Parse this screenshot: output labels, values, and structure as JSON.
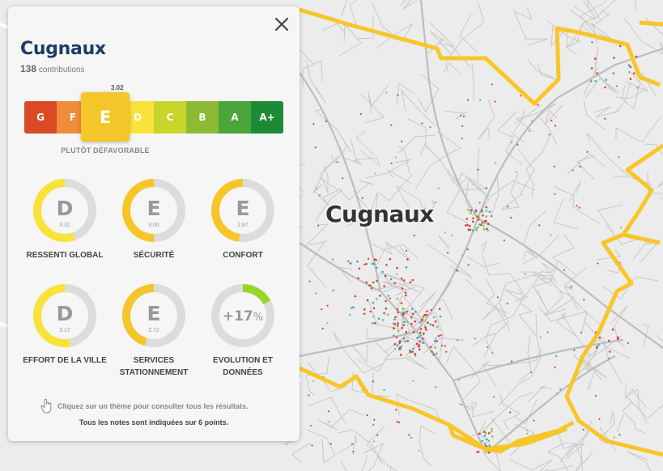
{
  "map": {
    "label": "Cugnaux"
  },
  "panel": {
    "title": "Cugnaux",
    "contributions_count": "138",
    "contributions_label": "contributions",
    "average_score": "3.02",
    "scale_caption": "PLUTÔT DÉFAVORABLE",
    "active_grade": "E",
    "grades": [
      {
        "label": "G",
        "color": "#d94a25"
      },
      {
        "label": "F",
        "color": "#ef8d3c"
      },
      {
        "label": "E",
        "color": "#f5c629"
      },
      {
        "label": "D",
        "color": "#f9e33a"
      },
      {
        "label": "C",
        "color": "#c9d52b"
      },
      {
        "label": "B",
        "color": "#8cbb33"
      },
      {
        "label": "A",
        "color": "#4aa53b"
      },
      {
        "label": "A+",
        "color": "#1e8a35"
      }
    ],
    "themes": [
      {
        "letter": "D",
        "score": "3.31",
        "label": "RESSENTI GLOBAL",
        "fraction": 0.5517,
        "color": "#f9e33a"
      },
      {
        "letter": "E",
        "score": "3.00",
        "label": "SÉCURITÉ",
        "fraction": 0.5,
        "color": "#f5c629"
      },
      {
        "letter": "E",
        "score": "2.87",
        "label": "CONFORT",
        "fraction": 0.4783,
        "color": "#f5c629"
      },
      {
        "letter": "D",
        "score": "3.17",
        "label": "EFFORT DE LA VILLE",
        "fraction": 0.5283,
        "color": "#f9e33a"
      },
      {
        "letter": "E",
        "score": "2.72",
        "label": "SERVICES STATIONNEMENT",
        "fraction": 0.4533,
        "color": "#f5c629"
      },
      {
        "letter": "+17",
        "unit": "%",
        "label": "EVOLUTION ET DONNÉES",
        "fraction": 0.17,
        "color": "#9ad42b"
      }
    ],
    "hint": "Cliquez sur un thème pour consulter tous les résultats.",
    "note": "Tous les notes sont indiquées sur 6 points."
  },
  "icons": {
    "close": "close-icon",
    "hand": "hand-pointer-icon"
  },
  "colors": {
    "title": "#1d3b66",
    "boundary": "#f7c628",
    "gauge_track": "#dcdcdc"
  }
}
